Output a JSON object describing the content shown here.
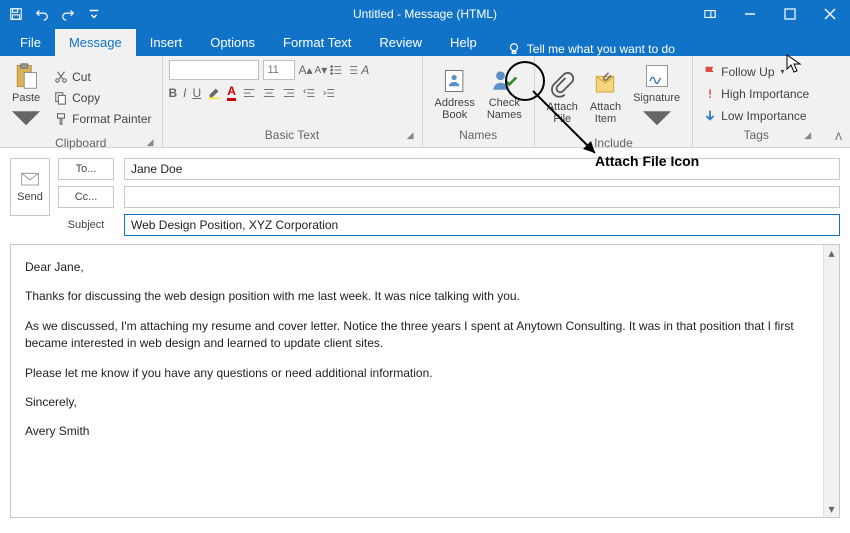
{
  "window": {
    "title": "Untitled - Message (HTML)"
  },
  "qat": {
    "save": "save",
    "undo": "undo",
    "redo": "redo"
  },
  "wincontrols": {
    "opts": "ribbon-display-options",
    "min": "minimize",
    "max": "maximize",
    "close": "close"
  },
  "tabs": [
    {
      "id": "file",
      "label": "File"
    },
    {
      "id": "message",
      "label": "Message"
    },
    {
      "id": "insert",
      "label": "Insert"
    },
    {
      "id": "options",
      "label": "Options"
    },
    {
      "id": "formattext",
      "label": "Format Text"
    },
    {
      "id": "review",
      "label": "Review"
    },
    {
      "id": "help",
      "label": "Help"
    }
  ],
  "active_tab": "message",
  "tellme": "Tell me what you want to do",
  "ribbon": {
    "clipboard": {
      "label": "Clipboard",
      "paste": "Paste",
      "cut": "Cut",
      "copy": "Copy",
      "fp": "Format Painter"
    },
    "basictext": {
      "label": "Basic Text",
      "font": "",
      "size": "11"
    },
    "names": {
      "label": "Names",
      "ab": "Address\nBook",
      "cn": "Check\nNames"
    },
    "include": {
      "label": "Include",
      "af": "Attach\nFile",
      "ai": "Attach\nItem",
      "sig": "Signature"
    },
    "tags": {
      "label": "Tags",
      "fu": "Follow Up",
      "hi": "High Importance",
      "li": "Low Importance"
    }
  },
  "send": "Send",
  "fields": {
    "to_label": "To...",
    "cc_label": "Cc...",
    "subj_label": "Subject",
    "to_value": "Jane Doe",
    "cc_value": "",
    "subj_value": "Web Design Position, XYZ Corporation"
  },
  "body": {
    "l1": "Dear Jane,",
    "l2": "Thanks for discussing the web design position with me last week. It was nice talking with you.",
    "l3": "As we discussed, I'm attaching my resume and cover letter. Notice the three years I spent at Anytown Consulting. It was in that position that I first became interested in web design and learned to update client sites.",
    "l4": "Please let me know if you have any questions or need additional information.",
    "l5": "Sincerely,",
    "l6": "Avery Smith"
  },
  "annotation": "Attach File Icon"
}
